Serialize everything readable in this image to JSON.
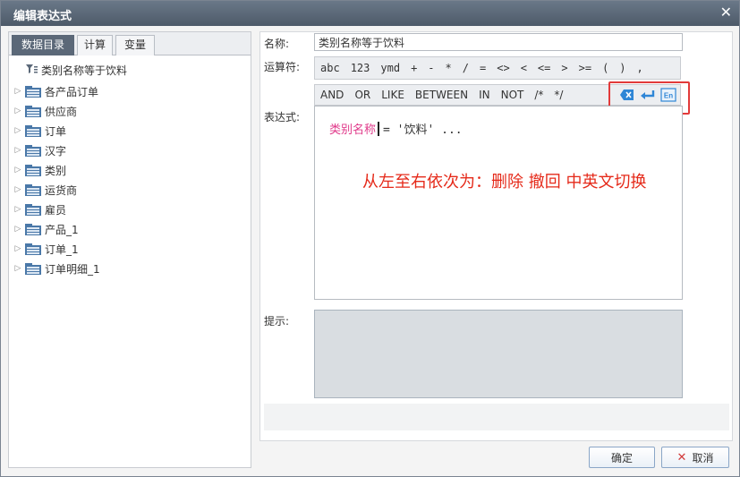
{
  "window": {
    "title": "编辑表达式",
    "close_glyph": "✕"
  },
  "tabs": [
    {
      "label": "数据目录",
      "active": true
    },
    {
      "label": "计算",
      "active": false
    },
    {
      "label": "变量",
      "active": false
    }
  ],
  "tree": {
    "root": {
      "label": "类别名称等于饮料",
      "icon": "filter-icon"
    },
    "items": [
      {
        "label": "各产品订单"
      },
      {
        "label": "供应商"
      },
      {
        "label": "订单"
      },
      {
        "label": "汉字"
      },
      {
        "label": "类别"
      },
      {
        "label": "运货商"
      },
      {
        "label": "雇员"
      },
      {
        "label": "产品_1"
      },
      {
        "label": "订单_1"
      },
      {
        "label": "订单明细_1"
      }
    ]
  },
  "form": {
    "name_label": "名称:",
    "name_value": "类别名称等于饮料",
    "operator_label": "运算符:",
    "operators": [
      "abc",
      "123",
      "ymd",
      "+",
      "-",
      "*",
      "/",
      "=",
      "<>",
      "<",
      "<=",
      ">",
      ">=",
      "(",
      ")",
      ","
    ],
    "keywords": [
      "AND",
      "OR",
      "LIKE",
      "BETWEEN",
      "IN",
      "NOT",
      "/*",
      "*/"
    ],
    "action_icons": [
      {
        "name": "delete-icon",
        "glyph": "✕"
      },
      {
        "name": "undo-icon",
        "glyph": "↵"
      },
      {
        "name": "language-toggle-icon",
        "glyph": "En"
      }
    ],
    "expression_label": "表达式:",
    "expression": {
      "field": "类别名称",
      "rest": "= '饮料' ..."
    },
    "annotation": "从左至右依次为：删除 撤回 中英文切换",
    "hint_label": "提示:"
  },
  "buttons": {
    "ok": "确定",
    "cancel": "取消",
    "cancel_glyph": "✕"
  },
  "colors": {
    "titlebar": "#5a6777",
    "active_tab": "#5b6878",
    "field_text": "#e0398a",
    "annotation": "#e52a1a",
    "highlight_border": "#e23a3a",
    "icon_blue": "#2f86d6"
  }
}
